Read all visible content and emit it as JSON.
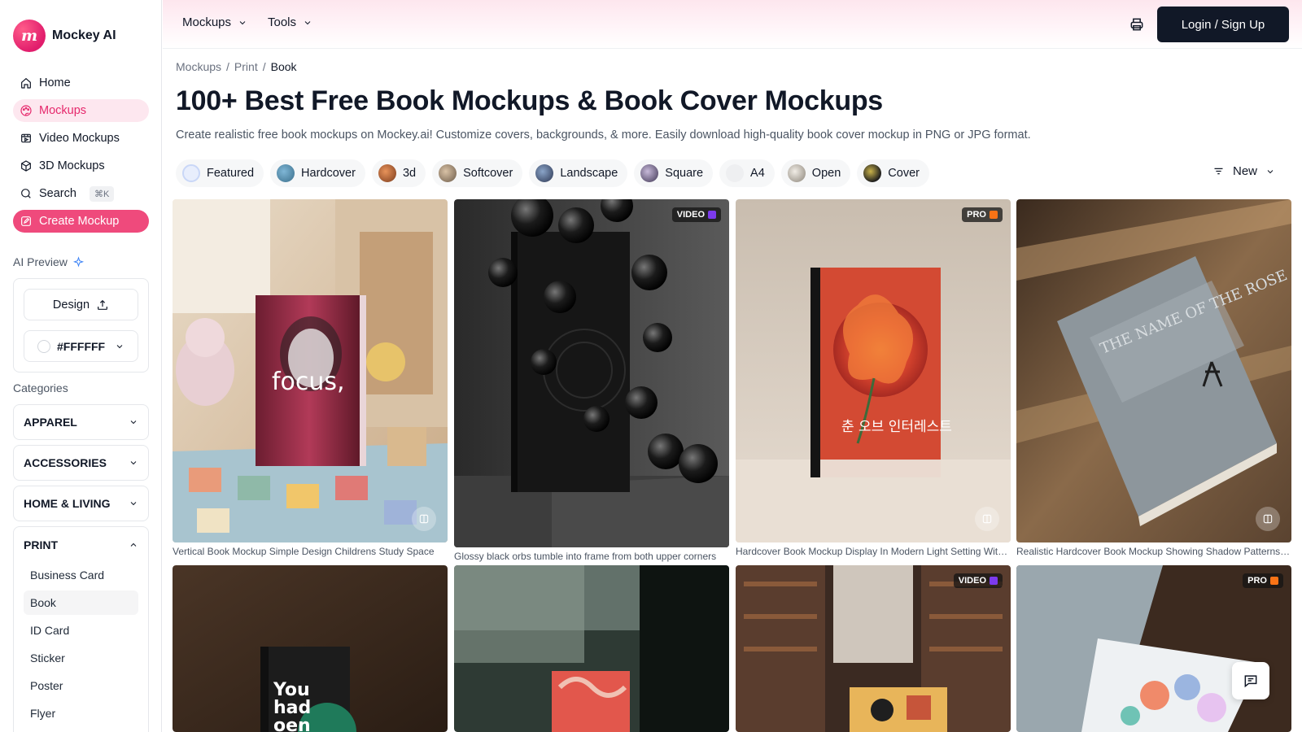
{
  "brand": {
    "name": "Mockey AI",
    "logo_letter": "m"
  },
  "sidebar": {
    "nav": [
      {
        "label": "Home",
        "icon": "home-icon"
      },
      {
        "label": "Mockups",
        "icon": "palette-icon"
      },
      {
        "label": "Video Mockups",
        "icon": "video-icon"
      },
      {
        "label": "3D Mockups",
        "icon": "cube-icon"
      },
      {
        "label": "Search",
        "icon": "search-icon",
        "shortcut": "⌘K"
      },
      {
        "label": "Create Mockup",
        "icon": "edit-icon"
      }
    ],
    "ai_preview": {
      "label": "AI Preview",
      "design_label": "Design",
      "color_value": "#FFFFFF"
    },
    "categories_title": "Categories",
    "categories": [
      "APPAREL",
      "ACCESSORIES",
      "HOME & LIVING"
    ],
    "open_category": {
      "label": "PRINT",
      "items": [
        "Business Card",
        "Book",
        "ID Card",
        "Sticker",
        "Poster",
        "Flyer"
      ]
    }
  },
  "header": {
    "menus": [
      "Mockups",
      "Tools"
    ],
    "login_label": "Login / Sign Up"
  },
  "breadcrumb": [
    "Mockups",
    "Print",
    "Book"
  ],
  "page": {
    "title": "100+ Best Free Book Mockups & Book Cover Mockups",
    "description": "Create realistic free book mockups on Mockey.ai! Customize covers, backgrounds, & more. Easily download high-quality book cover mockup in PNG or JPG format."
  },
  "filters": [
    "Featured",
    "Hardcover",
    "3d",
    "Softcover",
    "Landscape",
    "Square",
    "A4",
    "Open",
    "Cover"
  ],
  "sort_label": "New",
  "cards": [
    {
      "caption": "Vertical Book Mockup Simple Design Childrens Study Space",
      "badge": "",
      "cover_text": "focus,"
    },
    {
      "caption": "Glossy black orbs tumble into frame from both upper corners",
      "badge": "VIDEO",
      "cover_text": ""
    },
    {
      "caption": "Hardcover Book Mockup Display In Modern Light Setting With Flower",
      "badge": "PRO",
      "cover_text": "춘 오브 인터레스트"
    },
    {
      "caption": "Realistic Hardcover Book Mockup Showing Shadow Patterns On Wood",
      "badge": "",
      "cover_text": "THE NAME OF THE ROSE"
    },
    {
      "caption": "",
      "badge": "",
      "cover_text": "You had oen"
    },
    {
      "caption": "",
      "badge": "",
      "cover_text": ""
    },
    {
      "caption": "",
      "badge": "VIDEO",
      "cover_text": ""
    },
    {
      "caption": "",
      "badge": "PRO",
      "cover_text": ""
    }
  ],
  "colors": {
    "accent": "#ef4a7c",
    "accent_soft": "#fde7ef",
    "dark": "#111827",
    "video_dot": "#7c3aed",
    "pro_dot": "#f97316"
  }
}
